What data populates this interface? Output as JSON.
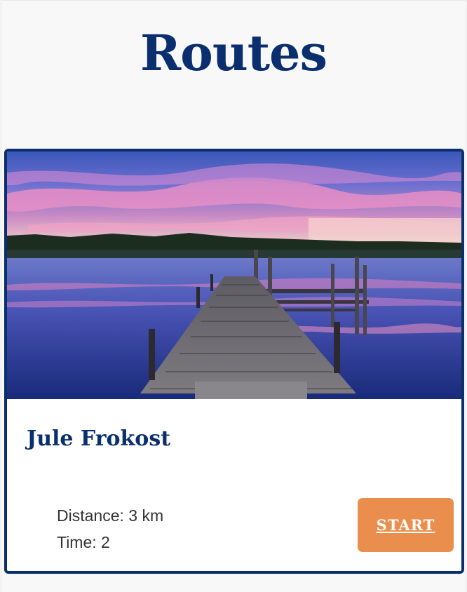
{
  "page": {
    "title": "Routes"
  },
  "route_card": {
    "image_label": "lake-dock-sunset-photo",
    "name": "Jule Frokost",
    "distance_label": "Distance:",
    "distance_value": "3 km",
    "time_label": "Time:",
    "time_value": "2",
    "start_label": "START"
  },
  "colors": {
    "title": "#0b2f6e",
    "card_border": "#0a2f6d",
    "start_button": "#e98e4d",
    "background": "#f8f8f8"
  }
}
